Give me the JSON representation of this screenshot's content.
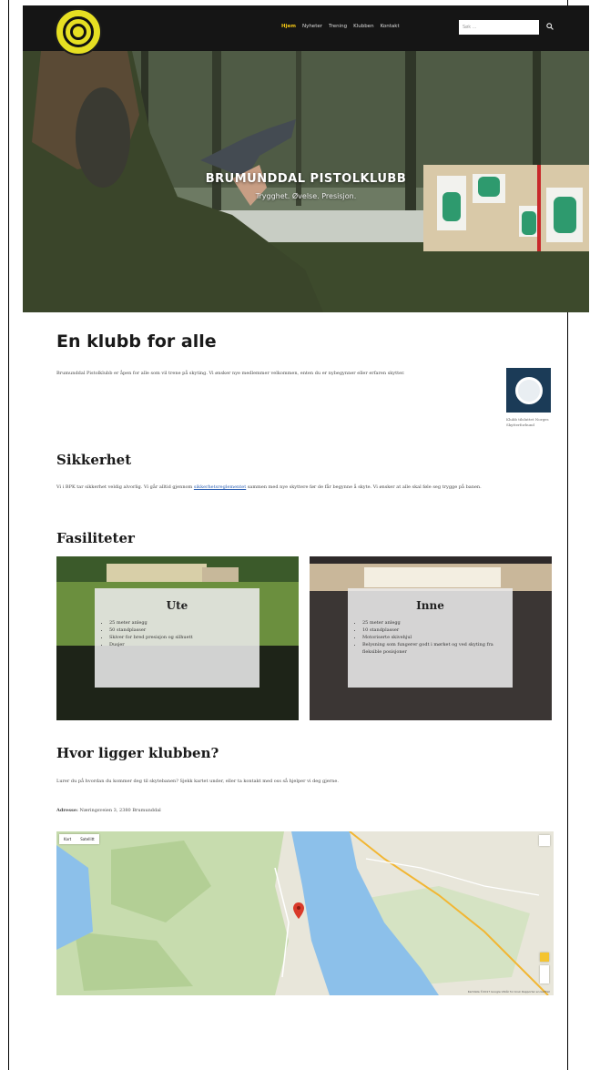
{
  "nav": {
    "menu": [
      "Hjem",
      "Nyheter",
      "Trening",
      "Klubben",
      "Kontakt"
    ],
    "search_placeholder": "Søk ..."
  },
  "hero": {
    "title": "BRUMUNDDAL PISTOLKLUBB",
    "subtitle": "Trygghet. Øvelse. Presisjon."
  },
  "intro": {
    "heading": "En klubb for alle",
    "text": "Brumunddal Pistolklubb er åpen for alle som vil trene på skyting. Vi ønsker nye medlemmer velkommen, enten du er nybegynner eller erfaren skytter.",
    "badge_caption": "Klubb tilsluttet Norges Skytterforbund"
  },
  "safety": {
    "heading": "Sikkerhet",
    "text_before": "Vi i BPK tar sikkerhet veldig alvorlig. Vi går alltid gjennom",
    "link": "sikkerhetsreglementet",
    "text_after": "sammen med nye skyttere før de får begynne å skyte. Vi ønsker at alle skal føle seg trygge på banen."
  },
  "facilities": {
    "heading": "Fasiliteter",
    "outdoor": {
      "title": "Ute",
      "items": [
        "25 meter anlegg",
        "50 standplasser",
        "Skiver for bred presisjon og silhuett",
        "Dusjer"
      ]
    },
    "indoor": {
      "title": "Inne",
      "items": [
        "25 meter anlegg",
        "10 standplasser",
        "Motoriserte skivehjul",
        "Belysning som fungerer godt i mørket og ved skyting fra fleksible posisjoner"
      ]
    }
  },
  "location": {
    "heading": "Hvor ligger klubben?",
    "text": "Lurer du på hvordan du kommer deg til skytebanen? Sjekk kartet under, eller ta kontakt med oss så hjelper vi deg gjerne.",
    "address_label": "Adresse:",
    "address": "Næringsveien 3, 2380 Brumunddal",
    "map_tabs": [
      "Kart",
      "Satellitt"
    ],
    "map_footer": "Kartdata ©2017 Google   Vilkår for bruk   Rapporter en kartfeil"
  },
  "colors": {
    "nav_bg": "#151515",
    "nav_active": "#f3c614",
    "link": "#2a5db0",
    "water": "#7ab6e8",
    "land_green": "#b9d3a0",
    "map_pin": "#d93a2a"
  }
}
